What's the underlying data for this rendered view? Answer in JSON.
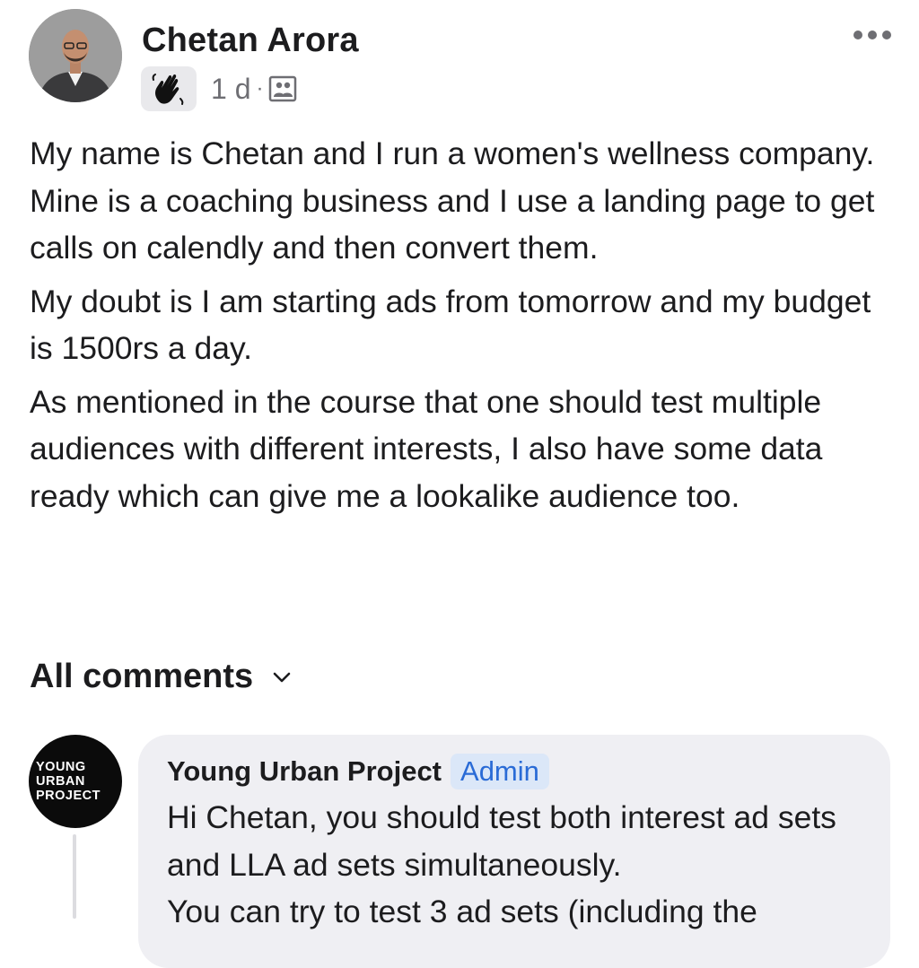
{
  "post": {
    "author": "Chetan Arora",
    "time": "1 d",
    "separator": "·",
    "badge_icon": "waving-hand-icon",
    "audience_icon": "group-members-icon",
    "paragraphs": [
      "My name is Chetan and I run a women's wellness company. Mine is a coaching business and I use a landing page to get calls on calendly and then convert them.",
      "My doubt is I am starting ads from tomorrow and my budget is 1500rs a day.",
      "As mentioned in the course that one should test multiple audiences with different interests, I also have some data ready which can give me a lookalike audience too."
    ]
  },
  "comments_section": {
    "title": "All comments"
  },
  "comment": {
    "author": "Young Urban Project",
    "role_badge": "Admin",
    "avatar_lines": [
      "YOUNG",
      "URBAN",
      "PROJECT"
    ],
    "lines": [
      "Hi Chetan, you should test both interest ad sets and LLA ad sets simultaneously.",
      "You can try to test 3 ad sets (including the"
    ]
  },
  "colors": {
    "admin_badge_text": "#2a6bd6",
    "admin_badge_bg": "#dbe7f8",
    "comment_bubble_bg": "#efeff3",
    "secondary_text": "#6e6e73"
  }
}
